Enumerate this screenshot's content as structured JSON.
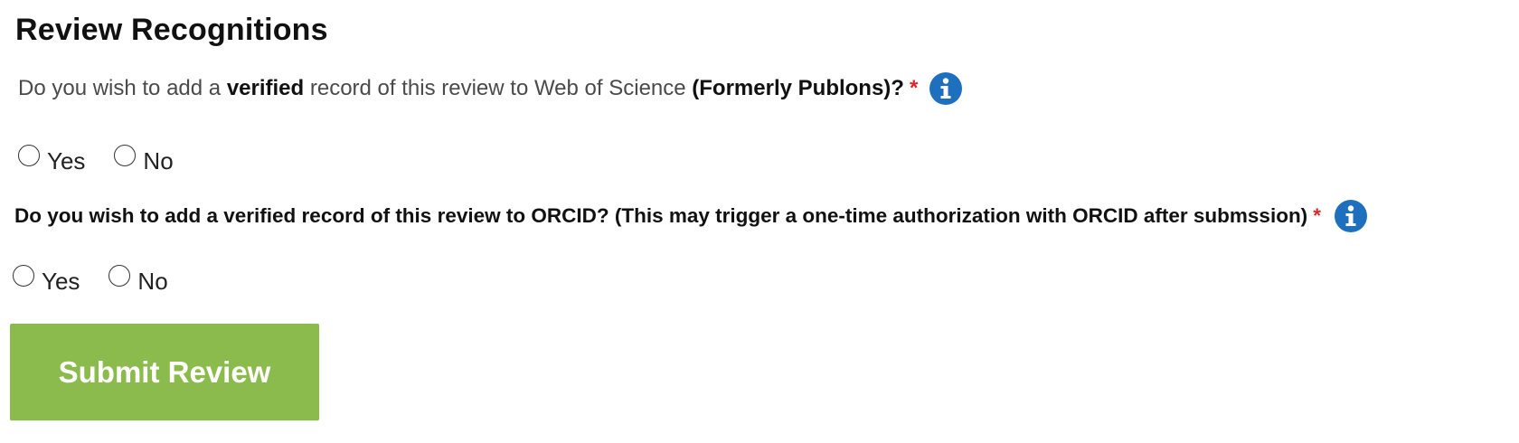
{
  "section_title": "Review Recognitions",
  "question_wos": {
    "prefix": "Do you wish to add a",
    "bold_word": "verified",
    "middle": "record of this review to Web of Science",
    "bold_suffix": "(Formerly Publons)?",
    "required_mark": "*",
    "info_icon": "info-circle-icon",
    "options": [
      "Yes",
      "No"
    ],
    "selected": null
  },
  "question_orcid": {
    "text": "Do you wish to add a verified record of this review to ORCID? (This may trigger a one-time authorization with ORCID after submssion)",
    "required_mark": "*",
    "info_icon": "info-circle-icon",
    "options": [
      "Yes",
      "No"
    ],
    "selected": null
  },
  "submit_label": "Submit Review",
  "colors": {
    "submit_bg": "#8bbb4c",
    "info_icon": "#1f6fbf",
    "required": "#e0262c"
  }
}
